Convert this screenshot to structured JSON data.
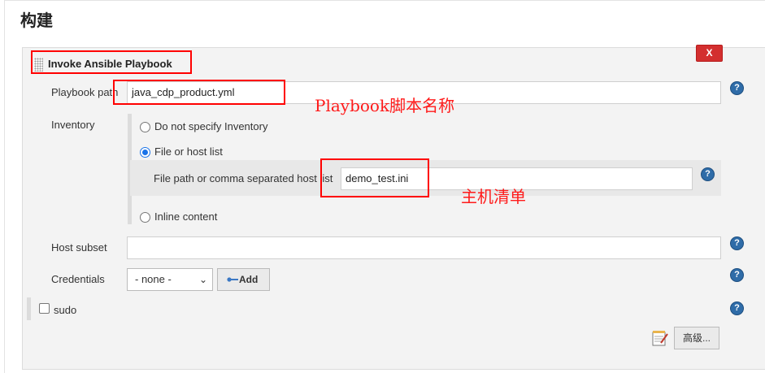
{
  "section": {
    "title": "构建"
  },
  "step": {
    "title": "Invoke Ansible Playbook",
    "delete_label": "X"
  },
  "form": {
    "playbook_path": {
      "label": "Playbook path",
      "value": "java_cdp_product.yml"
    },
    "inventory": {
      "label": "Inventory",
      "options": [
        {
          "label": "Do not specify Inventory",
          "selected": false
        },
        {
          "label": "File or host list",
          "selected": true
        },
        {
          "label": "Inline content",
          "selected": false
        }
      ],
      "file_path": {
        "label": "File path or comma separated host list",
        "value": "demo_test.ini"
      }
    },
    "host_subset": {
      "label": "Host subset",
      "value": ""
    },
    "credentials": {
      "label": "Credentials",
      "selected": "- none -",
      "add_label": "Add"
    },
    "sudo": {
      "label": "sudo",
      "checked": false
    },
    "advanced_label": "高级..."
  },
  "help_label": "?",
  "annotations": {
    "playbook_note": "Playbook脚本名称",
    "inventory_note": "主机清单"
  },
  "colors": {
    "annotation": "#ff1a1a",
    "delete_button": "#d32f2f",
    "help_icon": "#2f6ca8",
    "radio_selected": "#1a73e8"
  },
  "icons": {
    "help": "help-icon",
    "drag": "drag-handle-icon",
    "key": "key-icon",
    "notepad": "notepad-icon",
    "dropdown": "chevron-down-icon"
  }
}
